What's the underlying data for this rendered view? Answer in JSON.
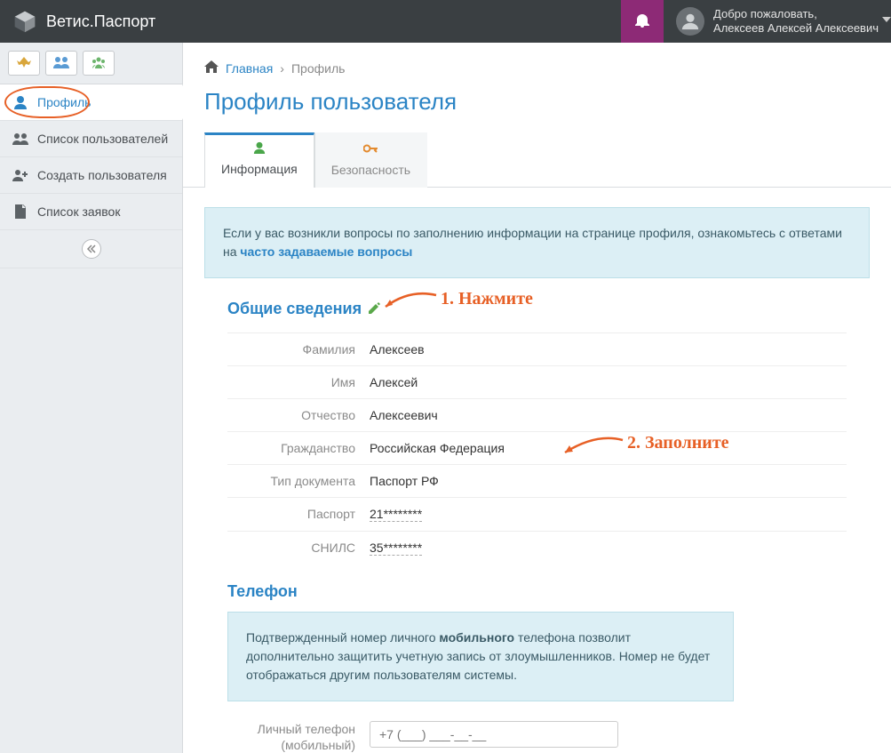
{
  "header": {
    "app_title": "Ветис.Паспорт",
    "welcome": "Добро пожаловать,",
    "user_name": "Алексеев Алексей Алексеевич"
  },
  "sidebar": {
    "items": [
      {
        "label": "Профиль"
      },
      {
        "label": "Список пользователей"
      },
      {
        "label": "Создать пользователя"
      },
      {
        "label": "Список заявок"
      }
    ]
  },
  "breadcrumb": {
    "home": "Главная",
    "current": "Профиль"
  },
  "page": {
    "title": "Профиль пользователя"
  },
  "tabs": {
    "info": "Информация",
    "security": "Безопасность"
  },
  "banner": {
    "text_a": "Если у вас возникли вопросы по заполнению информации на странице профиля, ознакомьтесь с ответами на ",
    "link": "часто задаваемые вопросы"
  },
  "section_general": {
    "title": "Общие сведения",
    "fields": {
      "lastname_label": "Фамилия",
      "lastname_value": "Алексеев",
      "firstname_label": "Имя",
      "firstname_value": "Алексей",
      "patronymic_label": "Отчество",
      "patronymic_value": "Алексеевич",
      "citizenship_label": "Гражданство",
      "citizenship_value": "Российская Федерация",
      "doctype_label": "Тип документа",
      "doctype_value": "Паспорт РФ",
      "passport_label": "Паспорт",
      "passport_value": "21********",
      "snils_label": "СНИЛС",
      "snils_value": "35********"
    }
  },
  "section_phone": {
    "title": "Телефон",
    "banner_a": "Подтвержденный номер личного ",
    "banner_bold": "мобильного",
    "banner_b": " телефона позволит дополнительно защитить учетную запись от злоумышленников. Номер не будет отображаться другим пользователям системы.",
    "label_a": "Личный телефон",
    "label_b": "(мобильный)",
    "placeholder": "+7 (___) ___-__-__"
  },
  "annotations": {
    "a1": "1. Нажмите",
    "a2": "2. Заполните"
  }
}
